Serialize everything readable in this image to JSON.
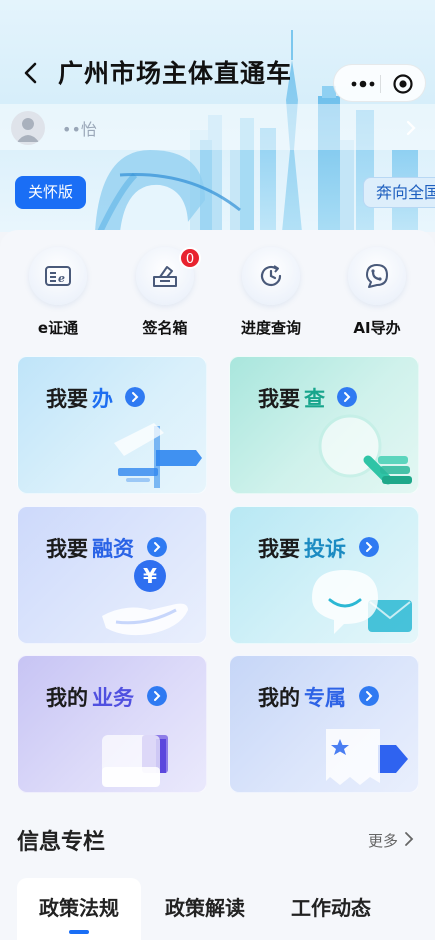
{
  "header": {
    "title": "广州市场主体直通车"
  },
  "user": {
    "name": "••怡"
  },
  "care_button": "关怀版",
  "forward_tag": "奔向全国",
  "quick_actions": [
    {
      "label": "e证通",
      "icon": "e-cert-icon"
    },
    {
      "label": "签名箱",
      "icon": "signature-box-icon",
      "badge": "0"
    },
    {
      "label": "进度查询",
      "icon": "clock-refresh-icon"
    },
    {
      "label": "AI导办",
      "icon": "ai-guide-icon"
    }
  ],
  "cards": [
    {
      "prefix": "我要",
      "accent": "办",
      "accent_color": "#1e6ef0",
      "icon": "signpost-icon"
    },
    {
      "prefix": "我要",
      "accent": "查",
      "accent_color": "#17a58c",
      "icon": "search-magnifier-icon"
    },
    {
      "prefix": "我要",
      "accent": "融资",
      "accent_color": "#2a63e6",
      "icon": "yuan-hand-icon"
    },
    {
      "prefix": "我要",
      "accent": "投诉",
      "accent_color": "#1b8bc2",
      "icon": "chat-bubble-icon"
    },
    {
      "prefix": "我的",
      "accent": "业务",
      "accent_color": "#5050e0",
      "icon": "folder-icon"
    },
    {
      "prefix": "我的",
      "accent": "专属",
      "accent_color": "#2e63e6",
      "icon": "star-ticket-icon"
    }
  ],
  "info_section": {
    "title": "信息专栏",
    "more": "更多"
  },
  "tabs": [
    {
      "label": "政策法规",
      "active": true
    },
    {
      "label": "政策解读",
      "active": false
    },
    {
      "label": "工作动态",
      "active": false
    }
  ]
}
